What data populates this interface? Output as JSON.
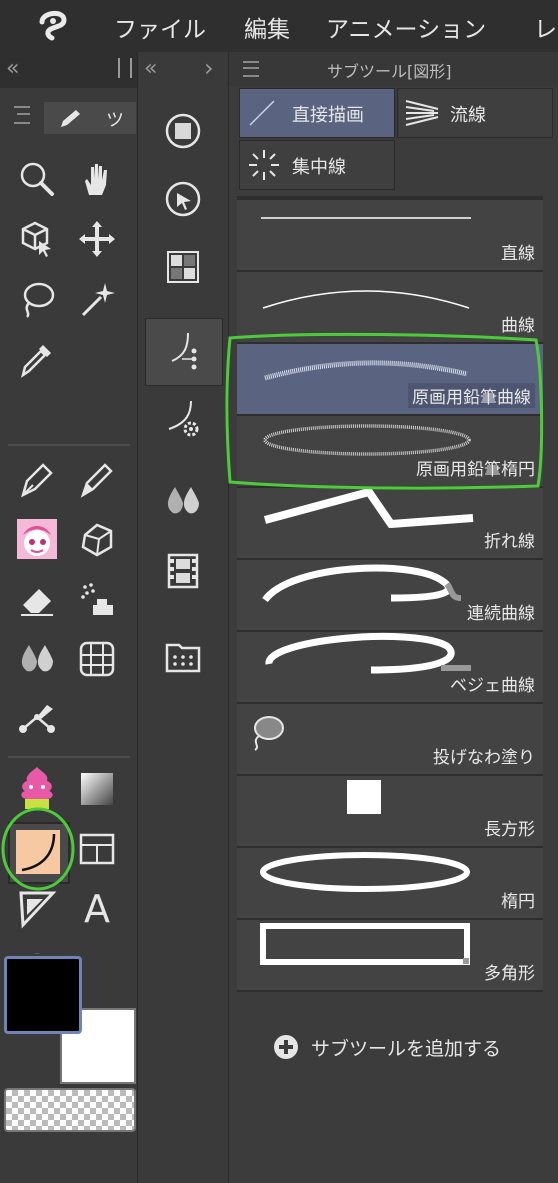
{
  "menubar": {
    "items": [
      "ファイル",
      "編集",
      "アニメーション",
      "レ"
    ],
    "app_icon": "clip-studio-logo-icon"
  },
  "tool_panel": {
    "header_collapse": "«",
    "tab_label": "ツ",
    "tools": [
      "zoom-icon",
      "hand-icon",
      "object-select-icon",
      "move-icon",
      "lasso-icon",
      "magic-wand-icon",
      "eyedropper-icon",
      "pen-icon",
      "pencil-icon",
      "brush-character-icon",
      "decoration-icon",
      "eraser-icon",
      "airbrush-icon",
      "blend-icon",
      "frame-border-icon",
      "correct-line-icon",
      "fill-icon",
      "gradient-icon",
      "figure-icon",
      "ruler-icon",
      "balloon-shape-icon",
      "text-icon",
      "speech-balloon-icon"
    ]
  },
  "tool_column2": {
    "collapse_left": "«",
    "expand_right": "›"
  },
  "subtool": {
    "title": "サブツール[図形]",
    "tabs": [
      {
        "label": "直接描画",
        "active": true
      },
      {
        "label": "流線",
        "active": false
      },
      {
        "label": "集中線",
        "active": false
      }
    ],
    "items": [
      {
        "label": "直線"
      },
      {
        "label": "曲線"
      },
      {
        "label": "原画用鉛筆曲線",
        "selected": true
      },
      {
        "label": "原画用鉛筆楕円"
      },
      {
        "label": "折れ線"
      },
      {
        "label": "連続曲線"
      },
      {
        "label": "ベジェ曲線"
      },
      {
        "label": "投げなわ塗り"
      },
      {
        "label": "長方形"
      },
      {
        "label": "楕円"
      },
      {
        "label": "多角形"
      }
    ],
    "add_label": "サブツールを追加する"
  },
  "colors": {
    "main": "#000000",
    "sub": "#ffffff",
    "accent_selected": "#5a6481",
    "highlight_ring": "#4dcc3a"
  }
}
